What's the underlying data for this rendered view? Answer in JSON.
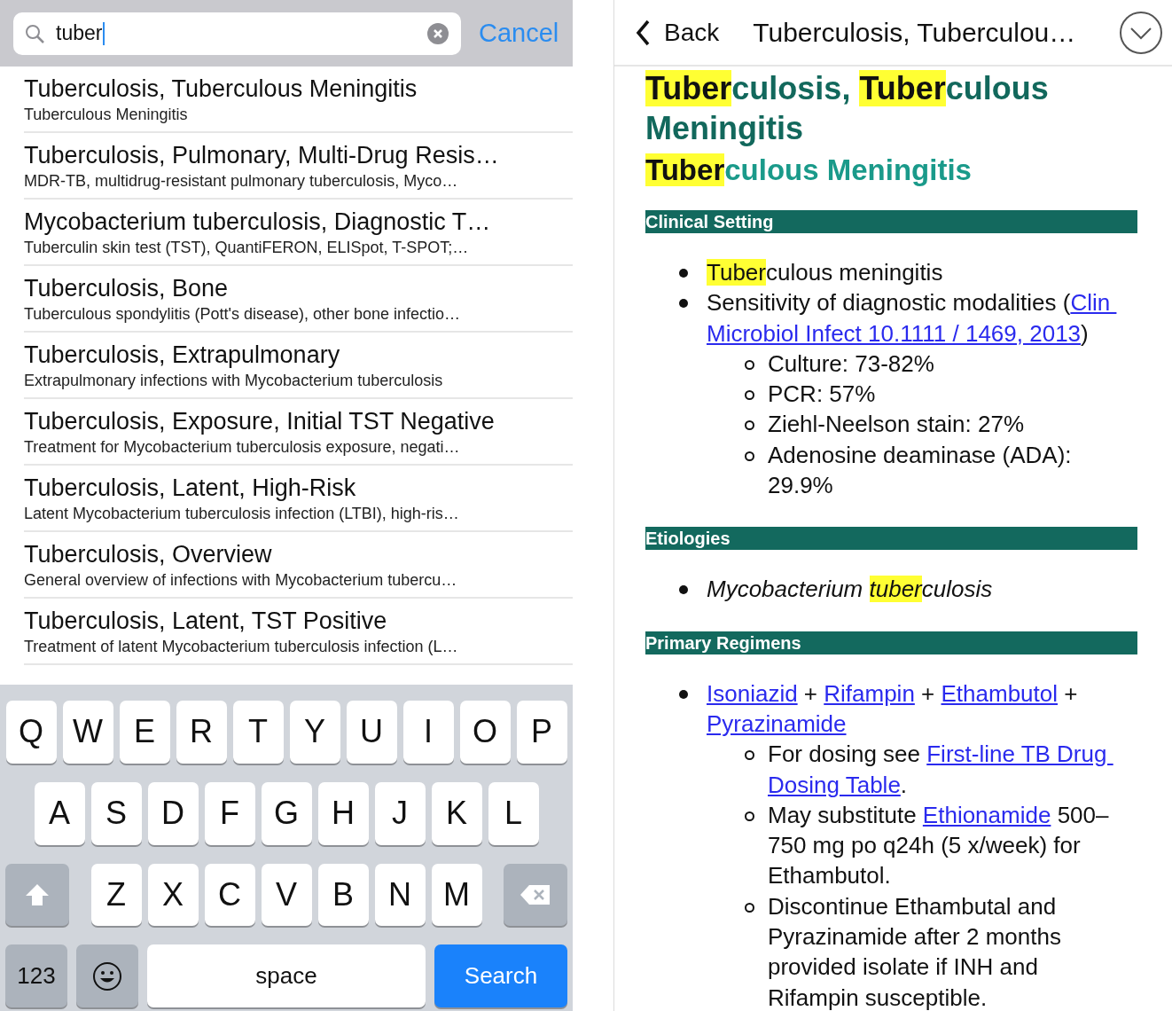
{
  "search": {
    "value": "tuber",
    "cancel": "Cancel"
  },
  "results": [
    {
      "title": "Tuberculosis, Tuberculous Meningitis",
      "subtitle": "Tuberculous Meningitis"
    },
    {
      "title": "Tuberculosis, Pulmonary, Multi-Drug Resis…",
      "subtitle": "MDR-TB, multidrug-resistant pulmonary tuberculosis, Myco…"
    },
    {
      "title": "Mycobacterium tuberculosis, Diagnostic T…",
      "subtitle": "Tuberculin skin test (TST), QuantiFERON, ELISpot, T-SPOT;…"
    },
    {
      "title": "Tuberculosis, Bone",
      "subtitle": "Tuberculous spondylitis (Pott's disease), other bone infectio…"
    },
    {
      "title": "Tuberculosis, Extrapulmonary",
      "subtitle": "Extrapulmonary infections with Mycobacterium tuberculosis"
    },
    {
      "title": "Tuberculosis, Exposure, Initial TST Negative",
      "subtitle": "Treatment for Mycobacterium tuberculosis exposure, negati…"
    },
    {
      "title": "Tuberculosis, Latent, High-Risk",
      "subtitle": "Latent Mycobacterium tuberculosis infection (LTBI), high-ris…"
    },
    {
      "title": "Tuberculosis, Overview",
      "subtitle": "General overview of infections with Mycobacterium tubercu…"
    },
    {
      "title": "Tuberculosis, Latent, TST Positive",
      "subtitle": "Treatment of latent Mycobacterium tuberculosis infection (L…"
    }
  ],
  "keyboard": {
    "rows": [
      {
        "keys": [
          {
            "kind": "letter",
            "label": "Q"
          },
          {
            "kind": "letter",
            "label": "W"
          },
          {
            "kind": "letter",
            "label": "E"
          },
          {
            "kind": "letter",
            "label": "R"
          },
          {
            "kind": "letter",
            "label": "T"
          },
          {
            "kind": "letter",
            "label": "Y"
          },
          {
            "kind": "letter",
            "label": "U"
          },
          {
            "kind": "letter",
            "label": "I"
          },
          {
            "kind": "letter",
            "label": "O"
          },
          {
            "kind": "letter",
            "label": "P"
          }
        ]
      },
      {
        "keys": [
          {
            "kind": "letter",
            "label": "A"
          },
          {
            "kind": "letter",
            "label": "S"
          },
          {
            "kind": "letter",
            "label": "D"
          },
          {
            "kind": "letter",
            "label": "F"
          },
          {
            "kind": "letter",
            "label": "G"
          },
          {
            "kind": "letter",
            "label": "H"
          },
          {
            "kind": "letter",
            "label": "J"
          },
          {
            "kind": "letter",
            "label": "K"
          },
          {
            "kind": "letter",
            "label": "L"
          }
        ]
      },
      {
        "keys": [
          {
            "kind": "shift"
          },
          {
            "kind": "letter",
            "label": "Z"
          },
          {
            "kind": "letter",
            "label": "X"
          },
          {
            "kind": "letter",
            "label": "C"
          },
          {
            "kind": "letter",
            "label": "V"
          },
          {
            "kind": "letter",
            "label": "B"
          },
          {
            "kind": "letter",
            "label": "N"
          },
          {
            "kind": "letter",
            "label": "M"
          },
          {
            "kind": "delete"
          }
        ]
      },
      {
        "keys": [
          {
            "kind": "numbers",
            "label": "123"
          },
          {
            "kind": "emoji"
          },
          {
            "kind": "space",
            "label": "space"
          },
          {
            "kind": "search",
            "label": "Search"
          }
        ]
      }
    ]
  },
  "detail": {
    "back": "Back",
    "title": "Tuberculosis, Tuberculou…",
    "heading": [
      {
        "kind": "highlight",
        "text": "Tuber"
      },
      {
        "kind": "text",
        "text": "culosis, "
      },
      {
        "kind": "highlight",
        "text": "Tuber"
      },
      {
        "kind": "text",
        "text": "culous Meningitis"
      }
    ],
    "subheading": [
      {
        "kind": "highlight",
        "text": "Tuber"
      },
      {
        "kind": "text",
        "text": "culous Meningitis"
      }
    ],
    "sections": [
      {
        "title": "Clinical Setting",
        "items": [
          {
            "italic": false,
            "segments": [
              {
                "kind": "highlight",
                "text": "Tuber"
              },
              {
                "kind": "text",
                "text": "culous meningitis"
              }
            ]
          },
          {
            "italic": false,
            "segments": [
              {
                "kind": "text",
                "text": "Sensitivity of diagnostic modalities ("
              },
              {
                "kind": "link",
                "text": "Clin "
              },
              {
                "kind": "link",
                "text": "Microbiol Infect 10.1111 / 1469, 2013"
              },
              {
                "kind": "text",
                "text": ")"
              }
            ],
            "children": [
              {
                "italic": false,
                "segments": [
                  {
                    "kind": "text",
                    "text": "Culture: 73-82%"
                  }
                ]
              },
              {
                "italic": false,
                "segments": [
                  {
                    "kind": "text",
                    "text": "PCR: 57%"
                  }
                ]
              },
              {
                "italic": false,
                "segments": [
                  {
                    "kind": "text",
                    "text": "Ziehl-Neelson stain: 27%"
                  }
                ]
              },
              {
                "italic": false,
                "segments": [
                  {
                    "kind": "text",
                    "text": "Adenosine deaminase (ADA): 29.9%"
                  }
                ]
              }
            ]
          }
        ]
      },
      {
        "title": "Etiologies",
        "items": [
          {
            "italic": true,
            "segments": [
              {
                "kind": "text",
                "text": "Mycobacterium "
              },
              {
                "kind": "highlight",
                "text": "tuber"
              },
              {
                "kind": "text",
                "text": "culosis"
              }
            ]
          }
        ]
      },
      {
        "title": "Primary Regimens",
        "items": [
          {
            "italic": false,
            "segments": [
              {
                "kind": "link",
                "text": "Isoniazid"
              },
              {
                "kind": "text",
                "text": " + "
              },
              {
                "kind": "link",
                "text": "Rifampin"
              },
              {
                "kind": "text",
                "text": " + "
              },
              {
                "kind": "link",
                "text": "Ethambutol"
              },
              {
                "kind": "text",
                "text": " + "
              },
              {
                "kind": "link",
                "text": "Pyrazinamide"
              }
            ],
            "children": [
              {
                "italic": false,
                "segments": [
                  {
                    "kind": "text",
                    "text": "For dosing see "
                  },
                  {
                    "kind": "link",
                    "text": "First-line TB Drug "
                  },
                  {
                    "kind": "link",
                    "text": "Dosing Table"
                  },
                  {
                    "kind": "text",
                    "text": "."
                  }
                ]
              },
              {
                "italic": false,
                "segments": [
                  {
                    "kind": "text",
                    "text": "May substitute "
                  },
                  {
                    "kind": "link",
                    "text": "Ethionamide"
                  },
                  {
                    "kind": "text",
                    "text": " 500–750 mg po q24h (5 x/week) for Ethambutol."
                  }
                ]
              },
              {
                "italic": false,
                "segments": [
                  {
                    "kind": "text",
                    "text": "Discontinue Ethambutal and Pyrazinamide after 2 months provided isolate if INH and Rifampin susceptible."
                  }
                ]
              }
            ]
          }
        ]
      }
    ]
  }
}
